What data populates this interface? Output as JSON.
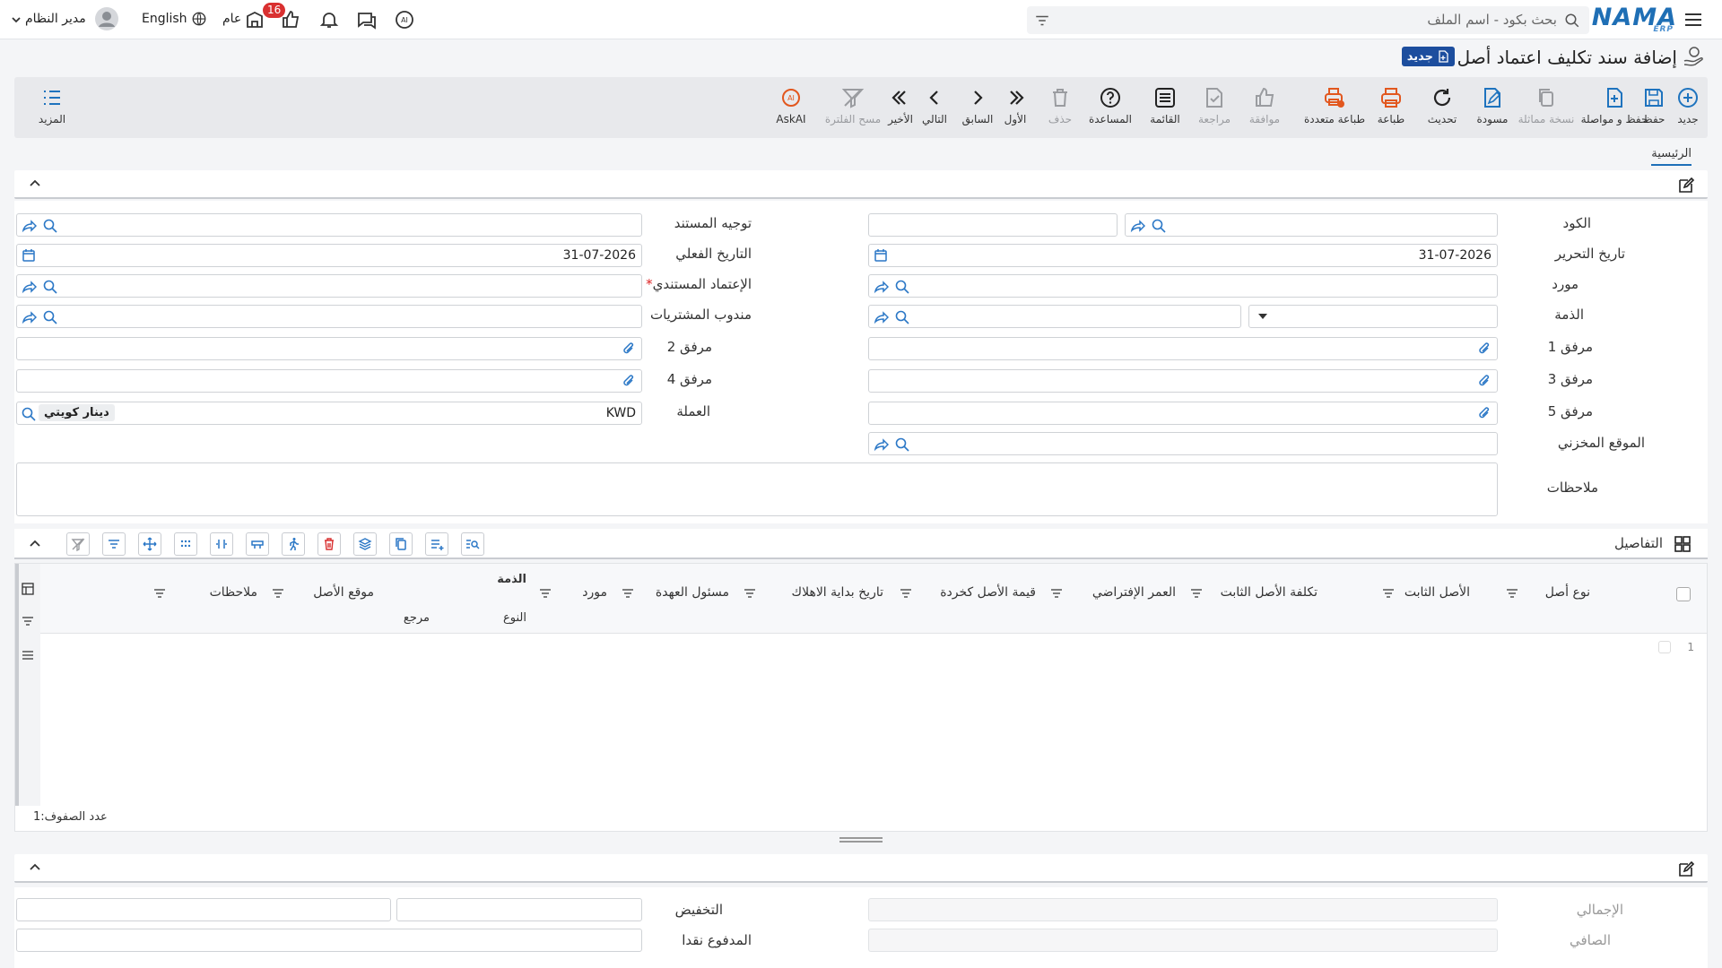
{
  "topbar": {
    "brand": "NAMA",
    "brand_sub": "ERP",
    "search_placeholder": "بحث بكود - اسم الملف",
    "user": "مدير النظام",
    "language": "English",
    "branch": "عام",
    "notification_count": "16"
  },
  "page": {
    "title": "إضافة سند تكليف اعتماد أصل",
    "status_badge": "جديد"
  },
  "toolbar": {
    "new": "جديد",
    "save": "حفظ",
    "save_continue": "حفظ و مواصلة",
    "copy": "نسخة مماثلة",
    "draft": "مسودة",
    "refresh": "تحديث",
    "print": "طباعة",
    "multi_print": "طباعة متعددة",
    "approve": "موافقة",
    "review": "مراجعة",
    "list": "القائمة",
    "help": "المساعدة",
    "delete": "حذف",
    "first": "الأول",
    "prev": "السابق",
    "next": "التالي",
    "last": "الأخير",
    "clear_filter": "مسح الفلترة",
    "askai": "AskAI",
    "more": "المزيد"
  },
  "tabs": {
    "main": "الرئيسية"
  },
  "form": {
    "code_label": "الكود",
    "doc_direction_label": "توجيه المستند",
    "edit_date_label": "تاريخ التحرير",
    "edit_date_value": "31-07-2026",
    "actual_date_label": "التاريخ الفعلي",
    "actual_date_value": "31-07-2026",
    "supplier_label": "مورد",
    "doc_approval_label": "الإعتماد المستندي",
    "account_label": "الذمة",
    "purchase_rep_label": "مندوب المشتريات",
    "attach1_label": "مرفق 1",
    "attach2_label": "مرفق 2",
    "attach3_label": "مرفق 3",
    "attach4_label": "مرفق 4",
    "attach5_label": "مرفق 5",
    "currency_label": "العملة",
    "currency_code": "KWD",
    "currency_name": "دينار كويتي",
    "warehouse_label": "الموقع المخزني",
    "notes_label": "ملاحظات"
  },
  "details": {
    "title": "التفاصيل",
    "columns": {
      "asset_type": "نوع أصل",
      "fixed_asset": "الأصل الثابت",
      "asset_cost": "تكلفة الأصل الثابت",
      "useful_life": "العمر الإفتراضي",
      "scrap_value": "قيمة الأصل كخردة",
      "depreciation_start": "تاريخ بداية الاهلاك",
      "custodian": "مسئول العهدة",
      "supplier": "مورد",
      "account_group": "الذمة",
      "account_type": "النوع",
      "account_ref": "مرجع",
      "asset_location": "موقع الأصل",
      "notes": "ملاحظات"
    },
    "row_number": "1",
    "row_count_label": "عدد الصفوف:",
    "row_count": "1"
  },
  "totals": {
    "total_label": "الإجمالي",
    "discount_label": "التخفيض",
    "net_label": "الصافي",
    "cash_paid_label": "المدفوع نقدا"
  }
}
